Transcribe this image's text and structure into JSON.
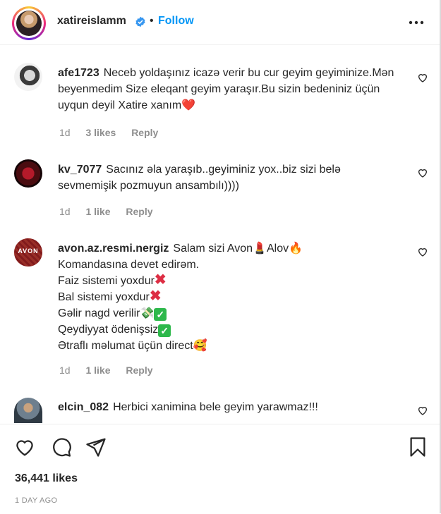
{
  "header": {
    "username": "xatireislamm",
    "separator": "•",
    "follow_label": "Follow",
    "verified_icon": "verified-badge-icon",
    "more_icon": "more-options-icon"
  },
  "comments": [
    {
      "username": "afe1723",
      "text": "Neceb yoldaşınız icazə verir bu cur geyim geyiminize.Mən beyenmedim Size eleqant geyim yaraşır.Bu sizin bedeniniz üçün uyqun deyil Xatire xanım",
      "emoji": "❤️",
      "time": "1d",
      "likes": "3 likes",
      "reply": "Reply"
    },
    {
      "username": "kv_7077",
      "text": "Sacınız əla yaraşıb..geyiminiz yox..biz sizi belə sevmemişik pozmuyun ansambılı))))",
      "time": "1d",
      "likes": "1 like",
      "reply": "Reply"
    },
    {
      "username": "avon.az.resmi.nergiz",
      "lines": [
        "Salam sizi Avon",
        "Alov",
        "Komandasına devet edirəm.",
        "Faiz sistemi yoxdur",
        "Bal sistemi yoxdur",
        "Gəlir nagd verilir",
        "Qeydiyyat ödenişsiz",
        "Ətraflı məlumat üçün direct"
      ],
      "emojis": {
        "lipstick": "💄",
        "fire": "🔥",
        "cross": "✖",
        "money": "💸",
        "check": "✓",
        "smile": "🥰"
      },
      "avatar_text": "AVON",
      "time": "1d",
      "likes": "1 like",
      "reply": "Reply"
    },
    {
      "username": "elcin_082",
      "text": "Herbici xanimina bele geyim yarawmaz!!!"
    }
  ],
  "footer": {
    "likes": "36,441 likes",
    "time": "1 DAY AGO"
  },
  "colors": {
    "link": "#0095f6",
    "muted": "#8e8e8e",
    "text": "#262626",
    "heart": "#e0245e"
  }
}
